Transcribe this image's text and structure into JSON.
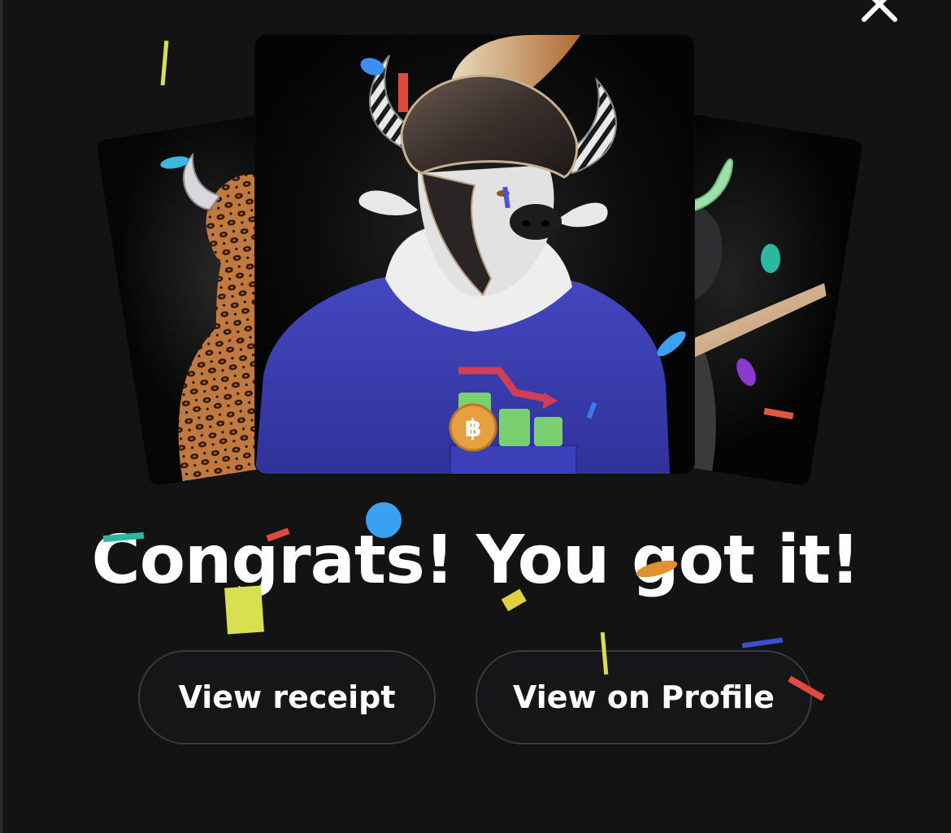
{
  "dialog": {
    "close_icon": "close-icon",
    "headline": "Congrats! You got it!"
  },
  "cards": {
    "left": {
      "subject": "leopard-print bull with chrome horns"
    },
    "center": {
      "subject": "bull in gladiator helmet wearing blue shirt with bitcoin chart"
    },
    "right": {
      "subject": "black bull with green horn holding bat"
    }
  },
  "actions": {
    "view_receipt": "View receipt",
    "view_on_profile": "View on Profile"
  },
  "colors": {
    "background": "#131314",
    "text": "#ffffff",
    "button_border": "#3a3a3f",
    "shirt_blue": "#3b3fb0",
    "confetti_blue": "#3aa0f0",
    "confetti_yellow": "#d8e050",
    "confetti_red": "#e04a3a"
  }
}
